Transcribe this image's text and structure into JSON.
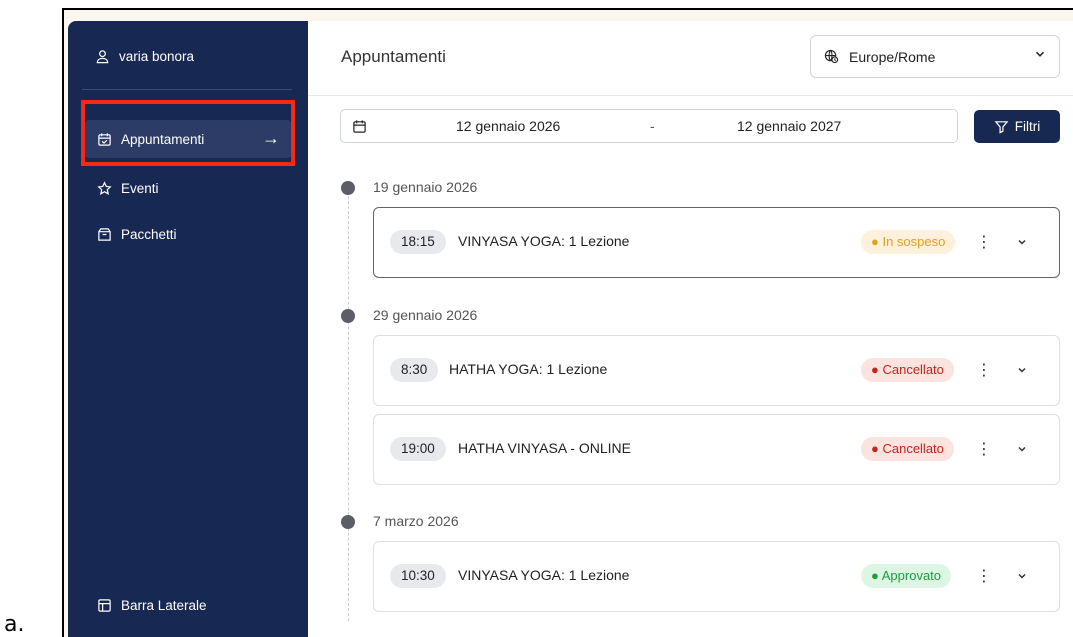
{
  "caption": "a.",
  "sidebar": {
    "user_name": "varia bonora",
    "items": [
      {
        "label": "Appuntamenti",
        "icon": "calendar-check-icon",
        "active": true
      },
      {
        "label": "Eventi",
        "icon": "star-icon",
        "active": false
      },
      {
        "label": "Pacchetti",
        "icon": "package-icon",
        "active": false
      }
    ],
    "bottom_label": "Barra Laterale"
  },
  "header": {
    "title": "Appuntamenti",
    "timezone": "Europe/Rome"
  },
  "filters": {
    "start_date": "12 gennaio 2026",
    "separator": "-",
    "end_date": "12 gennaio 2027",
    "filter_label": "Filtri"
  },
  "groups": [
    {
      "date": "19 gennaio 2026",
      "appointments": [
        {
          "time": "18:15",
          "title": "VINYASA YOGA: 1 Lezione",
          "status": "In sospeso",
          "status_type": "pending"
        }
      ]
    },
    {
      "date": "29 gennaio 2026",
      "appointments": [
        {
          "time": "8:30",
          "title": "HATHA YOGA: 1 Lezione",
          "status": "Cancellato",
          "status_type": "cancel"
        },
        {
          "time": "19:00",
          "title": "HATHA VINYASA - ONLINE",
          "status": "Cancellato",
          "status_type": "cancel"
        }
      ]
    },
    {
      "date": "7 marzo 2026",
      "appointments": [
        {
          "time": "10:30",
          "title": "VINYASA YOGA: 1 Lezione",
          "status": "Approvato",
          "status_type": "approve"
        }
      ]
    }
  ],
  "colors": {
    "sidebar_bg": "#172853",
    "highlight": "#f42a14",
    "pending": "#e0a020",
    "cancel": "#c2251c",
    "approve": "#1e9b40"
  }
}
